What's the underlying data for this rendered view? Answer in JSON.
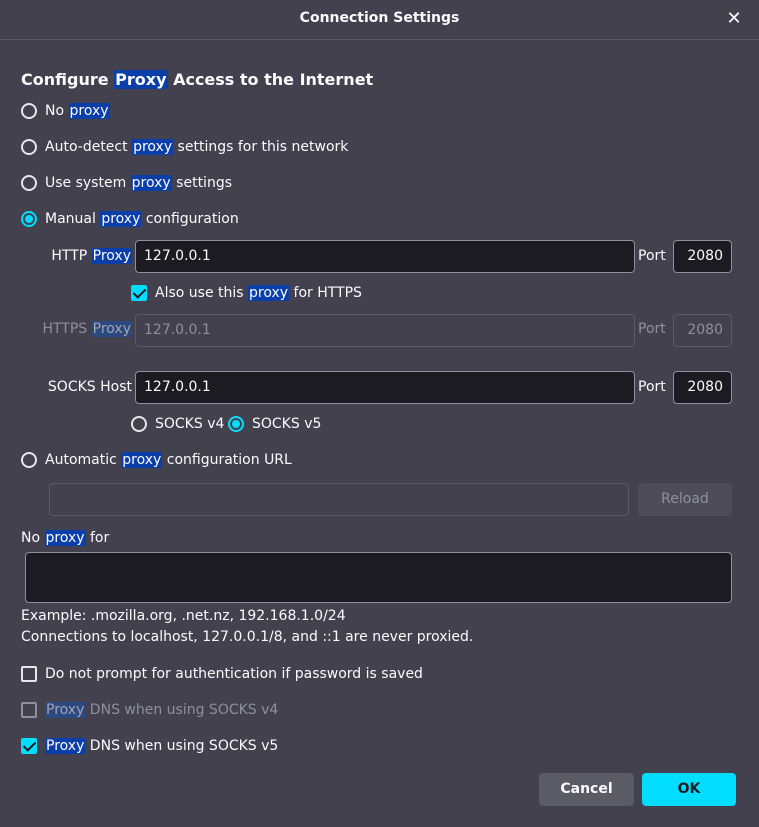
{
  "dialog": {
    "title": "Connection Settings",
    "close_glyph": "✕",
    "heading_pre": "Configure ",
    "heading_hl": "Proxy",
    "heading_post": " Access to the Internet"
  },
  "options": {
    "no_proxy": {
      "pre": "No ",
      "hl": "proxy",
      "post": "",
      "selected": false
    },
    "auto_detect": {
      "pre": "Auto-detect ",
      "hl": "proxy",
      "post": " settings for this network",
      "selected": false
    },
    "system": {
      "pre": "Use system ",
      "hl": "proxy",
      "post": " settings",
      "selected": false
    },
    "manual": {
      "pre": "Manual ",
      "hl": "proxy",
      "post": " configuration",
      "selected": true
    },
    "auto_url": {
      "pre": "Automatic ",
      "hl": "proxy",
      "post": " configuration URL",
      "selected": false
    }
  },
  "manual": {
    "http_label_pre": "HTTP ",
    "http_label_hl": "Proxy",
    "http_value": "127.0.0.1",
    "port_label": "Port",
    "http_port": "2080",
    "also_https_pre": "Also use this ",
    "also_https_hl": "proxy",
    "also_https_post": " for HTTPS",
    "also_https_checked": true,
    "https_label_pre": "HTTPS ",
    "https_label_hl": "Proxy",
    "https_value": "127.0.0.1",
    "https_port": "2080",
    "socks_label": "SOCKS Host",
    "socks_value": "127.0.0.1",
    "socks_port": "2080",
    "socks_v4": "SOCKS v4",
    "socks_v5": "SOCKS v5",
    "socks_selected": "v5"
  },
  "auto_url": {
    "value": "",
    "reload_label": "Reload"
  },
  "no_proxy_for": {
    "label_pre": "No ",
    "label_hl": "proxy",
    "label_post": " for",
    "value": ""
  },
  "notes": {
    "example": "Example: .mozilla.org, .net.nz, 192.168.1.0/24",
    "localhost": "Connections to localhost, 127.0.0.1/8, and ::1 are never proxied."
  },
  "checkboxes": {
    "no_prompt": {
      "label": "Do not prompt for authentication if password is saved",
      "checked": false
    },
    "dns_v4": {
      "hl": "Proxy",
      "post": " DNS when using SOCKS v4",
      "checked": false,
      "disabled": true
    },
    "dns_v5": {
      "hl": "Proxy",
      "post": " DNS when using SOCKS v5",
      "checked": true
    }
  },
  "buttons": {
    "cancel": "Cancel",
    "ok": "OK"
  },
  "colors": {
    "accent": "#00ddff",
    "background": "#42414d",
    "highlight": "#0a3ea8",
    "field": "#1c1b22"
  }
}
